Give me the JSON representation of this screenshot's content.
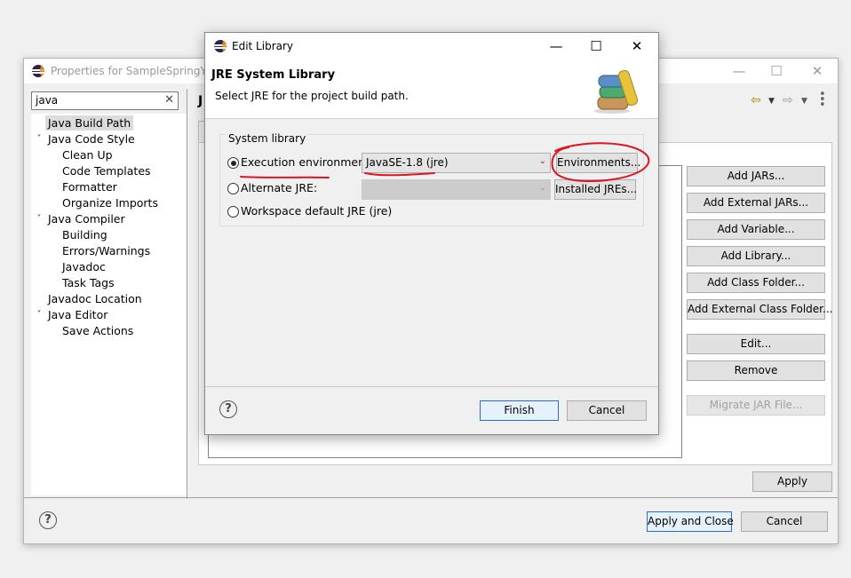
{
  "properties_window": {
    "title": "Properties for SampleSpringYse",
    "search_value": "java",
    "clear_symbol": "✕",
    "pane_title_fragment": "J",
    "tree": [
      {
        "label": "Java Build Path",
        "level": 0,
        "expandable": false,
        "selected": true
      },
      {
        "label": "Java Code Style",
        "level": 0,
        "expandable": true
      },
      {
        "label": "Clean Up",
        "level": 1
      },
      {
        "label": "Code Templates",
        "level": 1
      },
      {
        "label": "Formatter",
        "level": 1
      },
      {
        "label": "Organize Imports",
        "level": 1
      },
      {
        "label": "Java Compiler",
        "level": 0,
        "expandable": true
      },
      {
        "label": "Building",
        "level": 1
      },
      {
        "label": "Errors/Warnings",
        "level": 1
      },
      {
        "label": "Javadoc",
        "level": 1
      },
      {
        "label": "Task Tags",
        "level": 1
      },
      {
        "label": "Javadoc Location",
        "level": 0,
        "expandable": false
      },
      {
        "label": "Java Editor",
        "level": 0,
        "expandable": true
      },
      {
        "label": "Save Actions",
        "level": 1
      }
    ],
    "side_buttons": [
      {
        "label": "Add JARs...",
        "enabled": true
      },
      {
        "label": "Add External JARs...",
        "enabled": true
      },
      {
        "label": "Add Variable...",
        "enabled": true
      },
      {
        "label": "Add Library...",
        "enabled": true
      },
      {
        "label": "Add Class Folder...",
        "enabled": true
      },
      {
        "label": "Add External Class Folder...",
        "enabled": true
      },
      {
        "label": "Edit...",
        "enabled": true
      },
      {
        "label": "Remove",
        "enabled": true
      },
      {
        "label": "Migrate JAR File...",
        "enabled": false
      }
    ],
    "apply_label": "Apply",
    "apply_close_label": "Apply and Close",
    "cancel_label": "Cancel",
    "help_symbol": "?"
  },
  "dialog": {
    "title": "Edit Library",
    "heading": "JRE System Library",
    "description": "Select JRE for the project build path.",
    "group_label": "System library",
    "options": {
      "execution_env_label": "Execution environment:",
      "execution_env_value": "JavaSE-1.8 (jre)",
      "environments_button": "Environments...",
      "alternate_label": "Alternate JRE:",
      "alternate_value": "",
      "installed_button": "Installed JREs...",
      "workspace_label": "Workspace default JRE (jre)",
      "selected": "execution_environment"
    },
    "finish_label": "Finish",
    "cancel_label": "Cancel",
    "help_symbol": "?"
  },
  "colors": {
    "annotation": "#e0141e",
    "accent": "#2a6ad6"
  },
  "icons": [
    "eclipse-icon",
    "minimize-icon",
    "maximize-icon",
    "close-icon",
    "back-arrow-icon",
    "forward-arrow-icon",
    "menu-dots-icon",
    "library-books-icon",
    "help-icon",
    "dropdown-arrow-icon"
  ]
}
